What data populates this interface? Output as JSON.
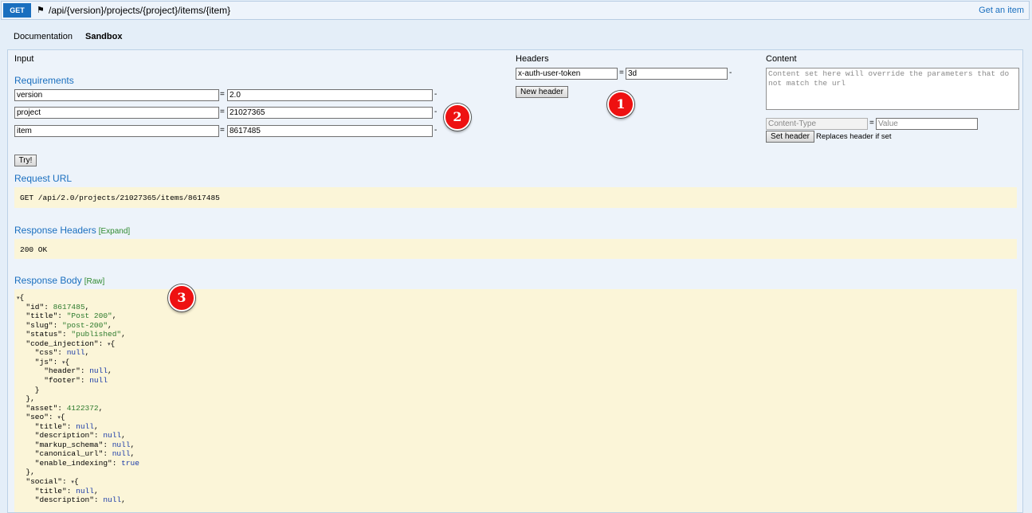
{
  "endpoint": {
    "method": "GET",
    "path": "/api/{version}/projects/{project}/items/{item}",
    "title": "Get an item"
  },
  "tabs": [
    "Documentation",
    "Sandbox"
  ],
  "input": {
    "heading": "Input",
    "requirements_heading": "Requirements",
    "params": [
      {
        "name": "version",
        "value": "2.0"
      },
      {
        "name": "project",
        "value": "21027365"
      },
      {
        "name": "item",
        "value": "8617485"
      }
    ],
    "eq": "=",
    "dash": "-",
    "try_label": "Try!"
  },
  "headers": {
    "heading": "Headers",
    "name": "x-auth-user-token",
    "value": "3d",
    "new_label": "New header"
  },
  "content": {
    "heading": "Content",
    "placeholder": "Content set here will override the parameters that do not match the url",
    "type_placeholder": "Content-Type",
    "value_placeholder": "Value",
    "set_label": "Set header",
    "note": "Replaces header if set"
  },
  "request": {
    "heading": "Request URL",
    "url": "GET /api/2.0/projects/21027365/items/8617485"
  },
  "response_headers": {
    "heading": "Response Headers",
    "toggle": "[Expand]",
    "status": "200 OK"
  },
  "response_body": {
    "heading": "Response Body",
    "toggle": "[Raw]",
    "lines": [
      "{",
      "  \"id\": 8617485,",
      "  \"title\": \"Post 200\",",
      "  \"slug\": \"post-200\",",
      "  \"status\": \"published\",",
      "  \"code_injection\": {",
      "    \"css\": null,",
      "    \"js\": {",
      "      \"header\": null,",
      "      \"footer\": null",
      "    }",
      "  },",
      "  \"asset\": 4122372,",
      "  \"seo\": {",
      "    \"title\": null,",
      "    \"description\": null,",
      "    \"markup_schema\": null,",
      "    \"canonical_url\": null,",
      "    \"enable_indexing\": true",
      "  },",
      "  \"social\": {",
      "    \"title\": null,",
      "    \"description\": null,"
    ]
  },
  "badges": [
    "1",
    "2",
    "3"
  ]
}
